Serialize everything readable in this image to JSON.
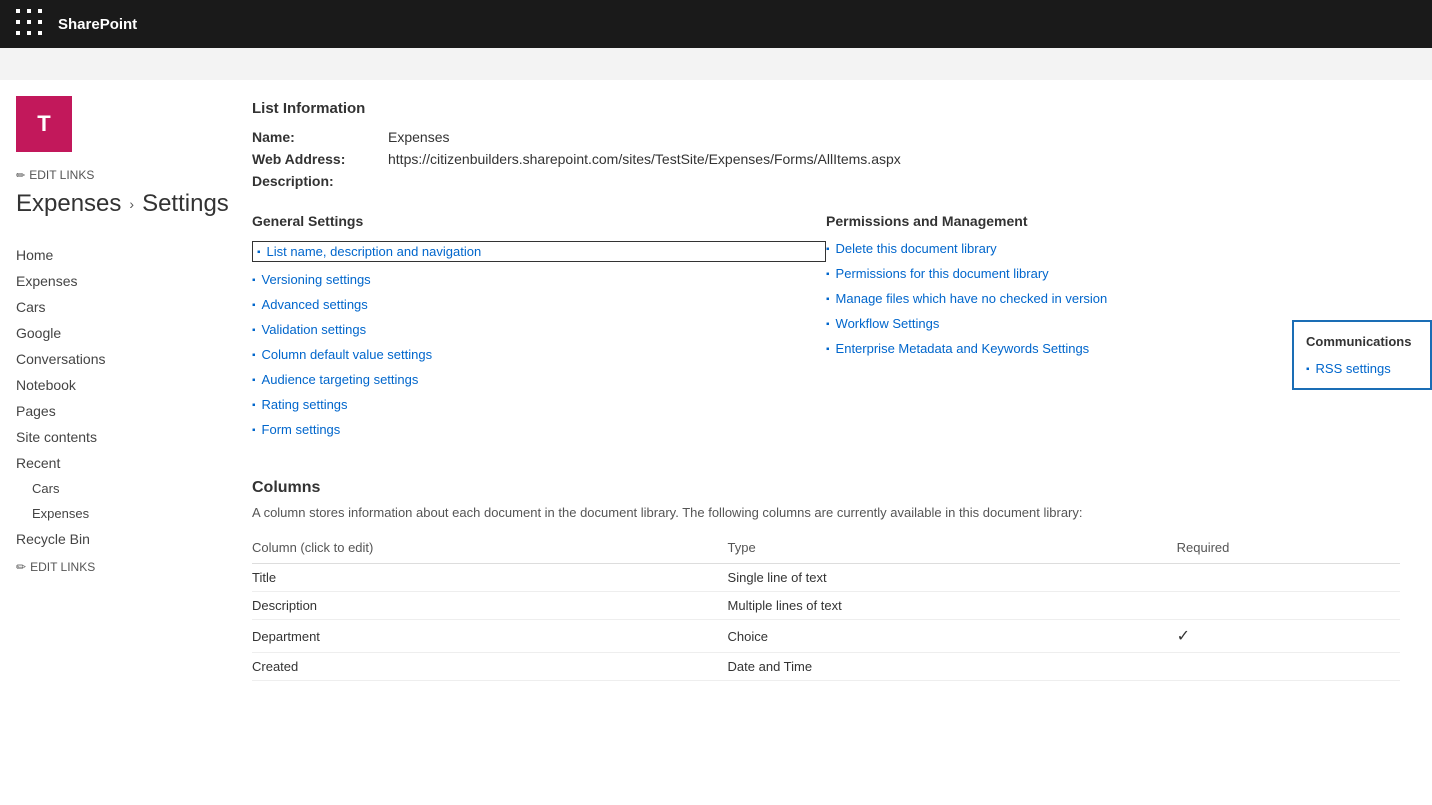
{
  "topbar": {
    "title": "SharePoint"
  },
  "header": {
    "edit_links_label": "EDIT LINKS",
    "site_logo_letter": "T",
    "breadcrumb_site": "Expenses",
    "breadcrumb_arrow": "›",
    "breadcrumb_page": "Settings"
  },
  "sidebar": {
    "edit_links_top": "EDIT LINKS",
    "items": [
      {
        "label": "Home",
        "level": 0
      },
      {
        "label": "Expenses",
        "level": 0
      },
      {
        "label": "Cars",
        "level": 0
      },
      {
        "label": "Google",
        "level": 0
      },
      {
        "label": "Conversations",
        "level": 0
      },
      {
        "label": "Notebook",
        "level": 0
      },
      {
        "label": "Pages",
        "level": 0
      },
      {
        "label": "Site contents",
        "level": 0
      },
      {
        "label": "Recent",
        "level": 0
      },
      {
        "label": "Cars",
        "level": 1
      },
      {
        "label": "Expenses",
        "level": 1
      },
      {
        "label": "Recycle Bin",
        "level": 0
      }
    ],
    "edit_links_bottom": "EDIT LINKS"
  },
  "list_info": {
    "section_title": "List Information",
    "name_label": "Name:",
    "name_value": "Expenses",
    "web_address_label": "Web Address:",
    "web_address_value": "https://citizenbuilders.sharepoint.com/sites/TestSite/Expenses/Forms/AllItems.aspx",
    "description_label": "Description:"
  },
  "general_settings": {
    "title": "General Settings",
    "links": [
      {
        "label": "List name, description and navigation",
        "active": true
      },
      {
        "label": "Versioning settings",
        "active": false
      },
      {
        "label": "Advanced settings",
        "active": false
      },
      {
        "label": "Validation settings",
        "active": false
      },
      {
        "label": "Column default value settings",
        "active": false
      },
      {
        "label": "Audience targeting settings",
        "active": false
      },
      {
        "label": "Rating settings",
        "active": false
      },
      {
        "label": "Form settings",
        "active": false
      }
    ]
  },
  "permissions": {
    "title": "Permissions and Management",
    "links": [
      {
        "label": "Delete this document library"
      },
      {
        "label": "Permissions for this document library"
      },
      {
        "label": "Manage files which have no checked in version"
      },
      {
        "label": "Workflow Settings"
      },
      {
        "label": "Enterprise Metadata and Keywords Settings"
      }
    ]
  },
  "communications": {
    "title": "Communications",
    "links": [
      {
        "label": "RSS settings"
      }
    ]
  },
  "columns": {
    "title": "Columns",
    "description": "A column stores information about each document in the document library. The following columns are currently available in this document library:",
    "headers": [
      "Column (click to edit)",
      "Type",
      "Required"
    ],
    "rows": [
      {
        "name": "Title",
        "type": "Single line of text",
        "required": false
      },
      {
        "name": "Description",
        "type": "Multiple lines of text",
        "required": false
      },
      {
        "name": "Department",
        "type": "Choice",
        "required": true
      },
      {
        "name": "Created",
        "type": "Date and Time",
        "required": false
      }
    ]
  }
}
